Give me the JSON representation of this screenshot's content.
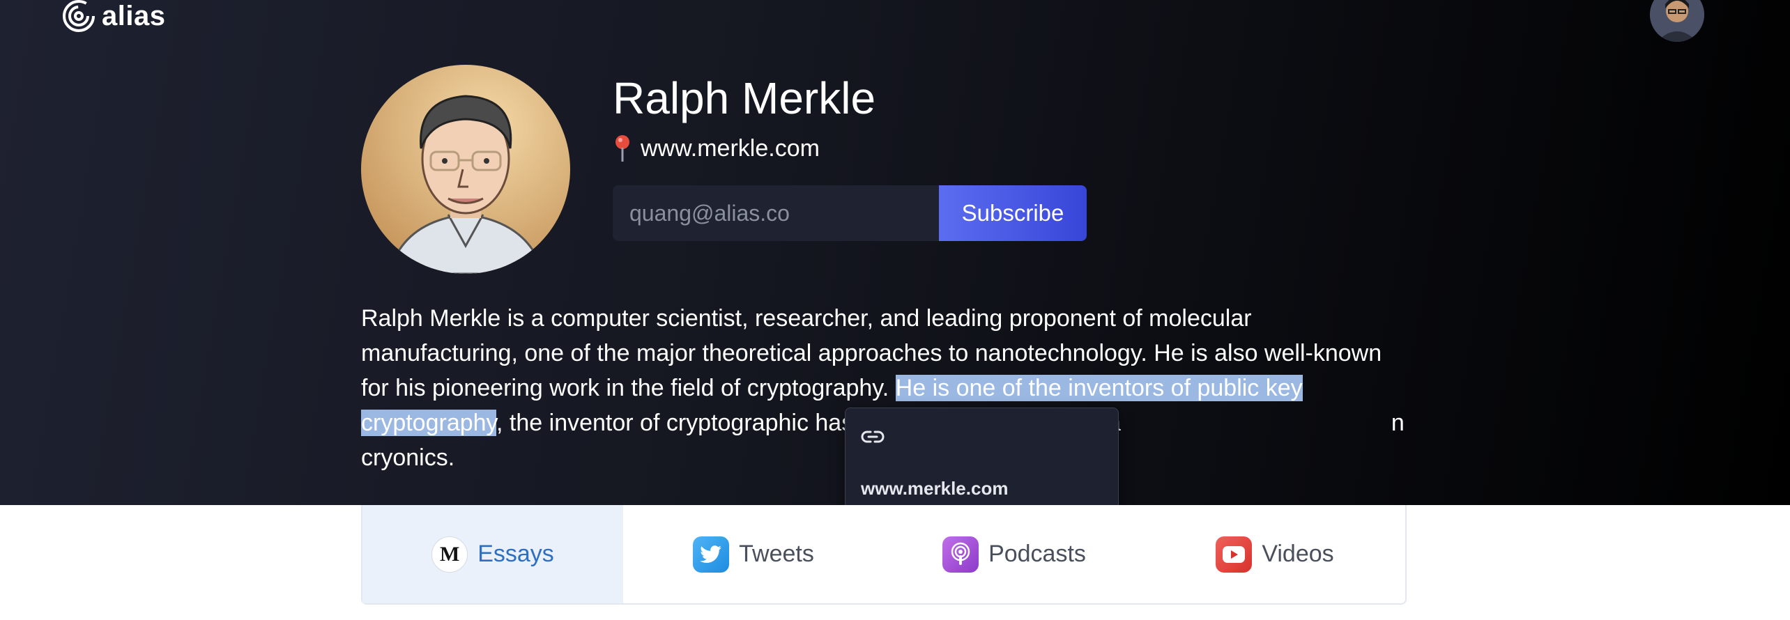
{
  "brand": {
    "name": "alias"
  },
  "profile": {
    "name": "Ralph Merkle",
    "website": "www.merkle.com"
  },
  "subscribe": {
    "placeholder": "quang@alias.co",
    "button_label": "Subscribe"
  },
  "bio": {
    "part1": "Ralph Merkle is a computer scientist, researcher, and leading proponent of molecular manufacturing, one of the major theoretical approaches to nanotechnology. He is also well-known for his pioneering work in the field of cryptography. ",
    "highlighted": "He is one of the inventors of public key cryptography",
    "part2": ", the inventor of cryptographic hashing, and more recently a",
    "part3": "n cryonics."
  },
  "link_popup": {
    "icon": "link-icon",
    "url": "www.merkle.com"
  },
  "tabs": [
    {
      "label": "Essays",
      "icon": "medium-icon",
      "active": true
    },
    {
      "label": "Tweets",
      "icon": "twitter-icon",
      "active": false
    },
    {
      "label": "Podcasts",
      "icon": "podcast-icon",
      "active": false
    },
    {
      "label": "Videos",
      "icon": "youtube-icon",
      "active": false
    }
  ],
  "colors": {
    "accent": "#4a5be6",
    "highlight": "#9bb8e3",
    "active_tab_text": "#2f6fc1",
    "active_tab_bg": "#eaf1fb"
  }
}
